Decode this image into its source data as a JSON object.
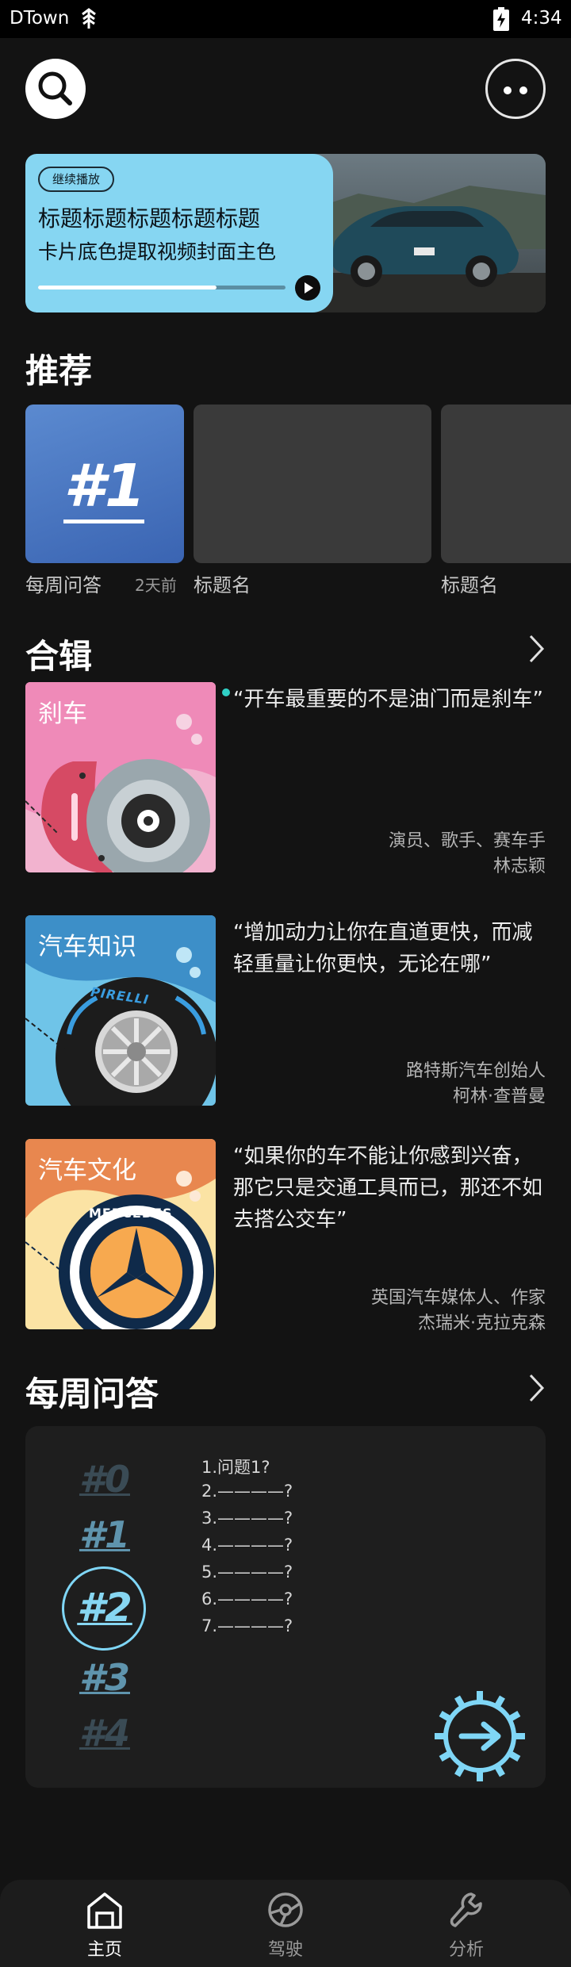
{
  "status_bar": {
    "carrier": "DTown",
    "time": "4:34"
  },
  "header": {
    "search_icon": "search-icon",
    "more_icon": "more-dots-icon"
  },
  "continue": {
    "badge": "继续播放",
    "title": "标题标题标题标题标题",
    "subtitle": "卡片底色提取视频封面主色",
    "progress": 0.72,
    "accent": "#86d6f2"
  },
  "recommend": {
    "title": "推荐",
    "items": [
      {
        "badge": "#1",
        "label": "每周问答",
        "time": "2天前"
      },
      {
        "label": "标题名"
      },
      {
        "label": "标题名"
      }
    ]
  },
  "collection": {
    "title": "合辑",
    "items": [
      {
        "tag": "刹车",
        "quote": "“开车最重要的不是油门而是刹车”",
        "role": "演员、歌手、赛车手",
        "name": "林志颖"
      },
      {
        "tag": "汽车知识",
        "quote": "“增加动力让你在直道更快，而减轻重量让你更快，无论在哪”",
        "role": "路特斯汽车创始人",
        "name": "柯林·查普曼",
        "brand": "PIRELLI"
      },
      {
        "tag": "汽车文化",
        "quote": "“如果你的车不能让你感到兴奋，那它只是交通工具而已，那还不如去搭公交车”",
        "role": "英国汽车媒体人、作家",
        "name": "杰瑞米·克拉克森",
        "brand": "MERCEDES"
      }
    ]
  },
  "weekly": {
    "title": "每周问答",
    "numbers": [
      "#0",
      "#1",
      "#2",
      "#3",
      "#4"
    ],
    "selected_index": 2,
    "questions": [
      "1.问题1?",
      "2.————?",
      "3.————?",
      "4.————?",
      "5.————?",
      "6.————?",
      "7.————?"
    ]
  },
  "nav": {
    "items": [
      {
        "label": "主页",
        "icon": "home-icon",
        "active": true
      },
      {
        "label": "驾驶",
        "icon": "steering-wheel-icon",
        "active": false
      },
      {
        "label": "分析",
        "icon": "wrench-icon",
        "active": false
      }
    ]
  }
}
